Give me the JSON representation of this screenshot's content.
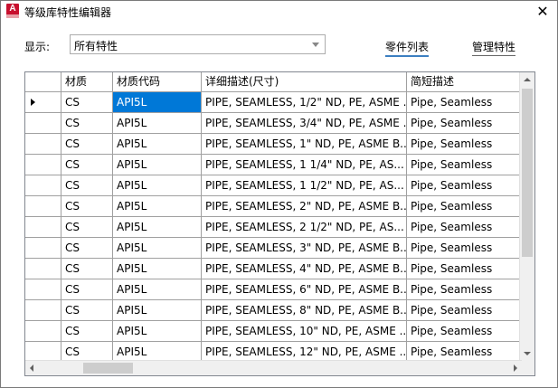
{
  "window": {
    "title": "等级库特性编辑器",
    "icon_letter": "A",
    "close_glyph": "✕"
  },
  "display": {
    "label": "显示:",
    "selected": "所有特性"
  },
  "links": {
    "parts_list": "零件列表",
    "manage_properties": "管理特性"
  },
  "table": {
    "columns": [
      "",
      "材质",
      "材质代码",
      "详细描述(尺寸)",
      "简短描述"
    ],
    "rows": [
      [
        "CS",
        "API5L",
        "PIPE, SEAMLESS, 1/2\" ND, PE, ASME ...",
        "Pipe, Seamless"
      ],
      [
        "CS",
        "API5L",
        "PIPE, SEAMLESS, 3/4\" ND, PE, ASME ...",
        "Pipe, Seamless"
      ],
      [
        "CS",
        "API5L",
        "PIPE, SEAMLESS, 1\" ND, PE, ASME B...",
        "Pipe, Seamless"
      ],
      [
        "CS",
        "API5L",
        "PIPE, SEAMLESS, 1 1/4\" ND, PE, AS...",
        "Pipe, Seamless"
      ],
      [
        "CS",
        "API5L",
        "PIPE, SEAMLESS, 1 1/2\" ND, PE, AS...",
        "Pipe, Seamless"
      ],
      [
        "CS",
        "API5L",
        "PIPE, SEAMLESS, 2\" ND, PE, ASME B...",
        "Pipe, Seamless"
      ],
      [
        "CS",
        "API5L",
        "PIPE, SEAMLESS, 2 1/2\" ND, PE, AS...",
        "Pipe, Seamless"
      ],
      [
        "CS",
        "API5L",
        "PIPE, SEAMLESS, 3\" ND, PE, ASME B...",
        "Pipe, Seamless"
      ],
      [
        "CS",
        "API5L",
        "PIPE, SEAMLESS, 4\" ND, PE, ASME B...",
        "Pipe, Seamless"
      ],
      [
        "CS",
        "API5L",
        "PIPE, SEAMLESS, 6\" ND, PE, ASME B...",
        "Pipe, Seamless"
      ],
      [
        "CS",
        "API5L",
        "PIPE, SEAMLESS, 8\" ND, PE, ASME B...",
        "Pipe, Seamless"
      ],
      [
        "CS",
        "API5L",
        "PIPE, SEAMLESS, 10\" ND, PE, ASME ...",
        "Pipe, Seamless"
      ],
      [
        "CS",
        "API5L",
        "PIPE, SEAMLESS, 12\" ND, PE, ASME ...",
        "Pipe, Seamless"
      ]
    ],
    "selected_row": 0,
    "selected_column": 1
  },
  "colors": {
    "selection": "#0078d7",
    "link_underline": "#3c7fc1",
    "app_icon": "#c8102e"
  }
}
